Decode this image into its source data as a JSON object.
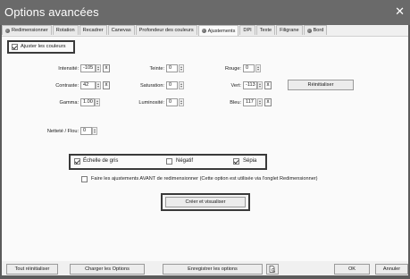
{
  "window": {
    "title": "Options avancées",
    "close_glyph": "✕"
  },
  "tabs": [
    {
      "label": "Redimensionner",
      "icon": "gear-icon"
    },
    {
      "label": "Rotation"
    },
    {
      "label": "Recadrer"
    },
    {
      "label": "Canevas"
    },
    {
      "label": "Profondeur des couleurs"
    },
    {
      "label": "Ajustements",
      "icon": "gear-icon",
      "active": true
    },
    {
      "label": "DPI"
    },
    {
      "label": "Texte"
    },
    {
      "label": "Filigrane"
    },
    {
      "label": "Bord",
      "icon": "gear-icon"
    }
  ],
  "adjust": {
    "enable_label": "Ajuster les couleurs",
    "enabled": true,
    "intensite": {
      "label": "Intensité:",
      "value": "-105"
    },
    "contraste": {
      "label": "Contraste:",
      "value": "42"
    },
    "gamma": {
      "label": "Gamma:",
      "value": "1.00"
    },
    "teinte": {
      "label": "Teinte:",
      "value": "0"
    },
    "saturation": {
      "label": "Saturation:",
      "value": "0"
    },
    "luminosite": {
      "label": "Luminosité:",
      "value": "0"
    },
    "rouge": {
      "label": "Rouge:",
      "value": "0"
    },
    "vert": {
      "label": "Vert:",
      "value": "-113"
    },
    "bleu": {
      "label": "Bleu:",
      "value": "117"
    },
    "nettete": {
      "label": "Netteté / Flou:",
      "value": "0"
    },
    "reset_label": "Réinitialiser",
    "x_glyph": "x"
  },
  "effects": {
    "grayscale": {
      "label": "Échelle de gris",
      "checked": true
    },
    "negative": {
      "label": "Négatif",
      "checked": false
    },
    "sepia": {
      "label": "Sépia",
      "checked": true
    }
  },
  "before_resize": {
    "label": "Faire les ajustements AVANT de redimensionner (Cette option est utilisée via l'onglet Redimensionner)",
    "checked": false
  },
  "create_preview_label": "Créer et visualiser",
  "footer": {
    "reset_all": "Tout réinitialiser",
    "load_options": "Charger les Options",
    "save_options": "Enregistrer les options",
    "ok": "OK",
    "cancel": "Annuler"
  }
}
